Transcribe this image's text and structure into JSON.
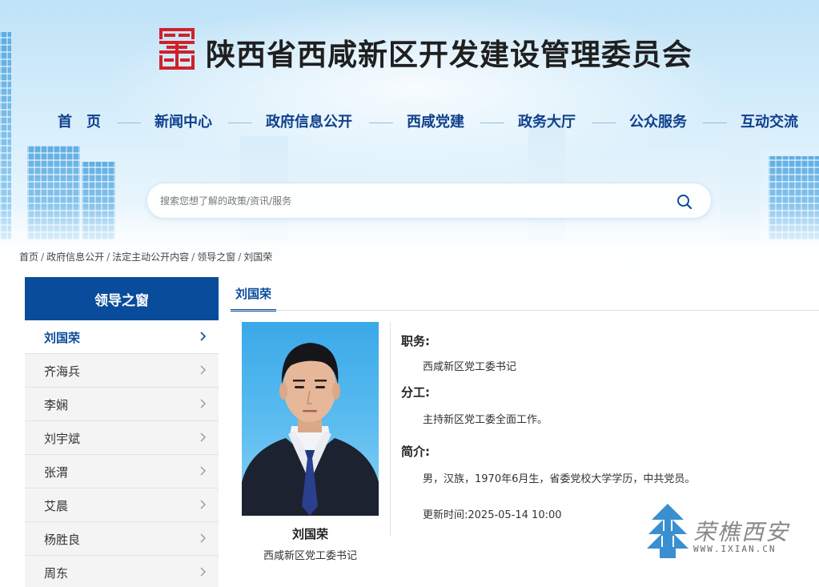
{
  "header": {
    "site_title": "陕西省西咸新区开发建设管理委员会",
    "logo_icon": "seal-logo-icon",
    "brand_red": "#d2202a"
  },
  "nav": {
    "items": [
      {
        "label": "首　页"
      },
      {
        "label": "新闻中心"
      },
      {
        "label": "政府信息公开"
      },
      {
        "label": "西咸党建"
      },
      {
        "label": "政务大厅"
      },
      {
        "label": "公众服务"
      },
      {
        "label": "互动交流"
      }
    ]
  },
  "search": {
    "placeholder": "搜索您想了解的政策/资讯/服务",
    "icon": "search-icon"
  },
  "breadcrumb": {
    "items": [
      "首页",
      "政府信息公开",
      "法定主动公开内容",
      "领导之窗",
      "刘国荣"
    ],
    "separator": "/"
  },
  "sidebar": {
    "title": "领导之窗",
    "items": [
      {
        "label": "刘国荣",
        "active": true
      },
      {
        "label": "齐海兵"
      },
      {
        "label": "李娴"
      },
      {
        "label": "刘宇斌"
      },
      {
        "label": "张渭"
      },
      {
        "label": "艾晨"
      },
      {
        "label": "杨胜良"
      },
      {
        "label": "周东"
      }
    ]
  },
  "content": {
    "tab_label": "刘国荣",
    "photo_name": "刘国荣",
    "photo_caption": "西咸新区党工委书记",
    "position_label": "职务:",
    "position_value": "西咸新区党工委书记",
    "duty_label": "分工:",
    "duty_value": "主持新区党工委全面工作。",
    "bio_label": "简介:",
    "bio_value": "男，汉族，1970年6月生，省委党校大学学历，中共党员。",
    "updated": "更新时间:2025-05-14 10:00"
  },
  "watermark": {
    "text": "荣樵西安",
    "url": "WWW.IXIAN.CN"
  },
  "colors": {
    "primary": "#0a4c9c",
    "nav_text": "#0f3f8c"
  }
}
